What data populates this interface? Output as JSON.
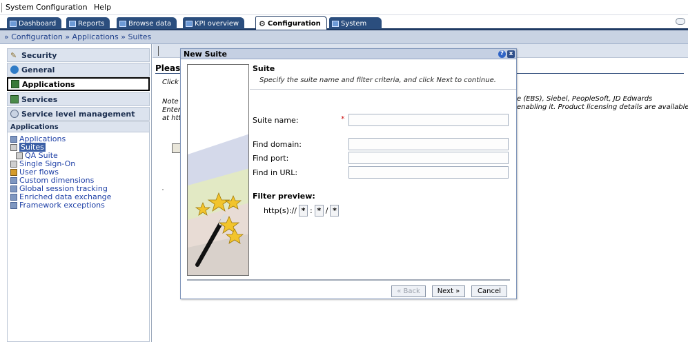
{
  "menubar": {
    "items": [
      "System",
      "Configuration",
      "Help"
    ]
  },
  "tabs": [
    {
      "label": "Dashboard",
      "icon": "dashboard-icon"
    },
    {
      "label": "Reports",
      "icon": "reports-icon"
    },
    {
      "label": "Browse data",
      "icon": "browse-data-icon"
    },
    {
      "label": "KPI overview",
      "icon": "kpi-icon"
    },
    {
      "label": "Configuration",
      "icon": "configuration-icon",
      "active": true
    },
    {
      "label": "System",
      "icon": "system-icon"
    }
  ],
  "breadcrumb": "» Configuration » Applications » Suites",
  "sidebar": {
    "accordions": [
      {
        "label": "Security",
        "icon": "security-icon"
      },
      {
        "label": "General",
        "icon": "general-icon"
      },
      {
        "label": "Applications",
        "icon": "applications-icon",
        "active": true
      },
      {
        "label": "Services",
        "icon": "services-icon"
      },
      {
        "label": "Service level management",
        "icon": "slm-icon"
      }
    ],
    "panel_title": "Applications",
    "links": [
      {
        "label": "Applications",
        "icon": "applications-icon"
      },
      {
        "label": "Suites",
        "icon": "suites-icon",
        "selected": true
      },
      {
        "label": "QA Suite",
        "icon": "suite-icon",
        "indent": true
      },
      {
        "label": "Single Sign-On",
        "icon": "sso-icon"
      },
      {
        "label": "User flows",
        "icon": "user-flows-icon"
      },
      {
        "label": "Custom dimensions",
        "icon": "custom-dimensions-icon"
      },
      {
        "label": "Global session tracking",
        "icon": "session-tracking-icon"
      },
      {
        "label": "Enriched data exchange",
        "icon": "data-exchange-icon"
      },
      {
        "label": "Framework exceptions",
        "icon": "framework-exceptions-icon"
      }
    ]
  },
  "main": {
    "heading": "Please",
    "click": "Click ",
    "note1": "Note ",
    "note2": "Enter",
    "note3": "at htt",
    "note_tail_a": "e (EBS), Siebel, PeopleSoft, JD Edwards",
    "note_tail_b": "enabling it. Product licensing details are available"
  },
  "dialog": {
    "title": "New Suite",
    "help_label": "?",
    "close_label": "x",
    "section_title": "Suite",
    "section_subtitle": "Specify the suite name and filter criteria, and click Next to continue.",
    "suite_name_label": "Suite name:",
    "required_mark": "*",
    "find_domain_label": "Find domain:",
    "find_port_label": "Find port:",
    "find_url_label": "Find in URL:",
    "suite_name_value": "",
    "find_domain_value": "",
    "find_port_value": "",
    "find_url_value": "",
    "filter_preview_title": "Filter preview:",
    "filter_prefix": "http(s)://",
    "filter_domain": "*",
    "filter_sep1": ":",
    "filter_port": "*",
    "filter_sep2": "/",
    "filter_url": "*",
    "back_label": "« Back",
    "next_label": "Next »",
    "cancel_label": "Cancel"
  }
}
